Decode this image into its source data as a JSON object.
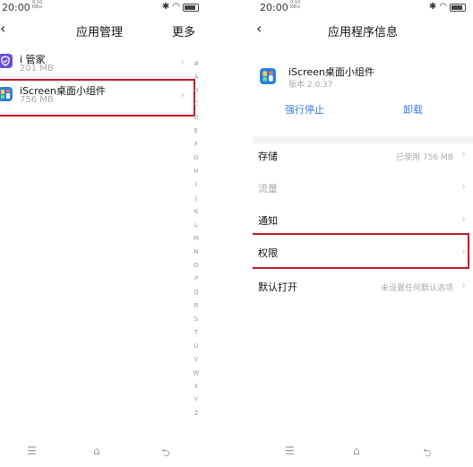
{
  "status": {
    "time": "20:00",
    "net_speed_value": "0.10",
    "net_speed_unit": "KB/s",
    "battery_label": "80"
  },
  "left": {
    "title": "应用管理",
    "more": "更多",
    "apps": [
      {
        "name": "i 管家",
        "size": "201 MB"
      },
      {
        "name": "iScreen桌面小组件",
        "size": "756 MB"
      }
    ],
    "index_letters": [
      "#",
      "A",
      "B",
      "C",
      "D",
      "E",
      "F",
      "G",
      "H",
      "I",
      "J",
      "K",
      "L",
      "M",
      "N",
      "O",
      "P",
      "Q",
      "R",
      "S",
      "T",
      "U",
      "V",
      "W",
      "X",
      "Y",
      "Z"
    ]
  },
  "right": {
    "title": "应用程序信息",
    "app": {
      "name": "iScreen桌面小组件",
      "version": "版本 2.0.37"
    },
    "actions": {
      "force_stop": "强行停止",
      "uninstall": "卸载"
    },
    "settings": [
      {
        "label": "存储",
        "value": "已使用 756 MB"
      },
      {
        "label": "流量",
        "value": ""
      },
      {
        "label": "通知",
        "value": ""
      },
      {
        "label": "权限",
        "value": ""
      },
      {
        "label": "默认打开",
        "value": "未设置任何默认选项"
      }
    ]
  },
  "nav": {
    "menu_glyph": "☰",
    "home_glyph": "⌂",
    "back_glyph": "⮌"
  },
  "colors": {
    "highlight": "#c4162a",
    "link": "#3a7be0"
  }
}
